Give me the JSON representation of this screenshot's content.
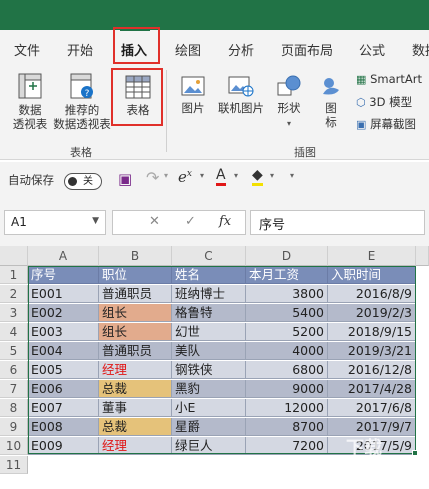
{
  "ribbon_tabs": [
    "文件",
    "开始",
    "插入",
    "绘图",
    "分析",
    "页面布局",
    "公式",
    "数据"
  ],
  "active_tab": "插入",
  "ribbon": {
    "pivot_label_1": "数据",
    "pivot_label_2": "透视表",
    "rec_pivot_label_1": "推荐的",
    "rec_pivot_label_2": "数据透视表",
    "table_label": "表格",
    "group_tables": "表格",
    "pictures_label": "图片",
    "online_pictures_label": "联机图片",
    "shapes_label": "形状",
    "icons_label_1": "图",
    "icons_label_2": "标",
    "smartart_label": "SmartArt",
    "model3d_label": "3D 模型",
    "screenshot_label": "屏幕截图",
    "group_illustrations": "插图"
  },
  "qat": {
    "autosave_label": "自动保存",
    "autosave_state": "关"
  },
  "formula_bar": {
    "name_box": "A1",
    "fx": "fx",
    "cancel": "✕",
    "confirm": "✓",
    "value": "序号"
  },
  "columns": [
    "A",
    "B",
    "C",
    "D",
    "E"
  ],
  "row_numbers": [
    "1",
    "2",
    "3",
    "4",
    "5",
    "6",
    "7",
    "8",
    "9",
    "10",
    "11"
  ],
  "table": {
    "headers": [
      "序号",
      "职位",
      "姓名",
      "本月工资",
      "入职时间"
    ],
    "rows": [
      [
        "E001",
        "普通职员",
        "班纳博士",
        "3800",
        "2016/8/9"
      ],
      [
        "E002",
        "组长",
        "格鲁特",
        "5400",
        "2019/2/3"
      ],
      [
        "E003",
        "组长",
        "幻世",
        "5200",
        "2018/9/15"
      ],
      [
        "E004",
        "普通职员",
        "美队",
        "4000",
        "2019/3/21"
      ],
      [
        "E005",
        "经理",
        "钢铁侠",
        "6800",
        "2016/12/8"
      ],
      [
        "E006",
        "总裁",
        "黑豹",
        "9000",
        "2017/4/28"
      ],
      [
        "E007",
        "董事",
        "小E",
        "12000",
        "2017/6/8"
      ],
      [
        "E008",
        "总裁",
        "星爵",
        "8700",
        "2017/9/7"
      ],
      [
        "E009",
        "经理",
        "绿巨人",
        "7200",
        "2017/5/9"
      ]
    ]
  },
  "cell_fills": {
    "组长": "#e2ab8d",
    "总裁": "#e5c27a",
    "经理": "#d4d8e2"
  },
  "colors": {
    "accent_green": "#217346",
    "highlight_red": "#e0302a",
    "header_fill": "#7a8db8",
    "band_light": "#d4d8e2",
    "band_dark": "#b4bacb",
    "text_red": "#e01717"
  },
  "watermark": "下载"
}
